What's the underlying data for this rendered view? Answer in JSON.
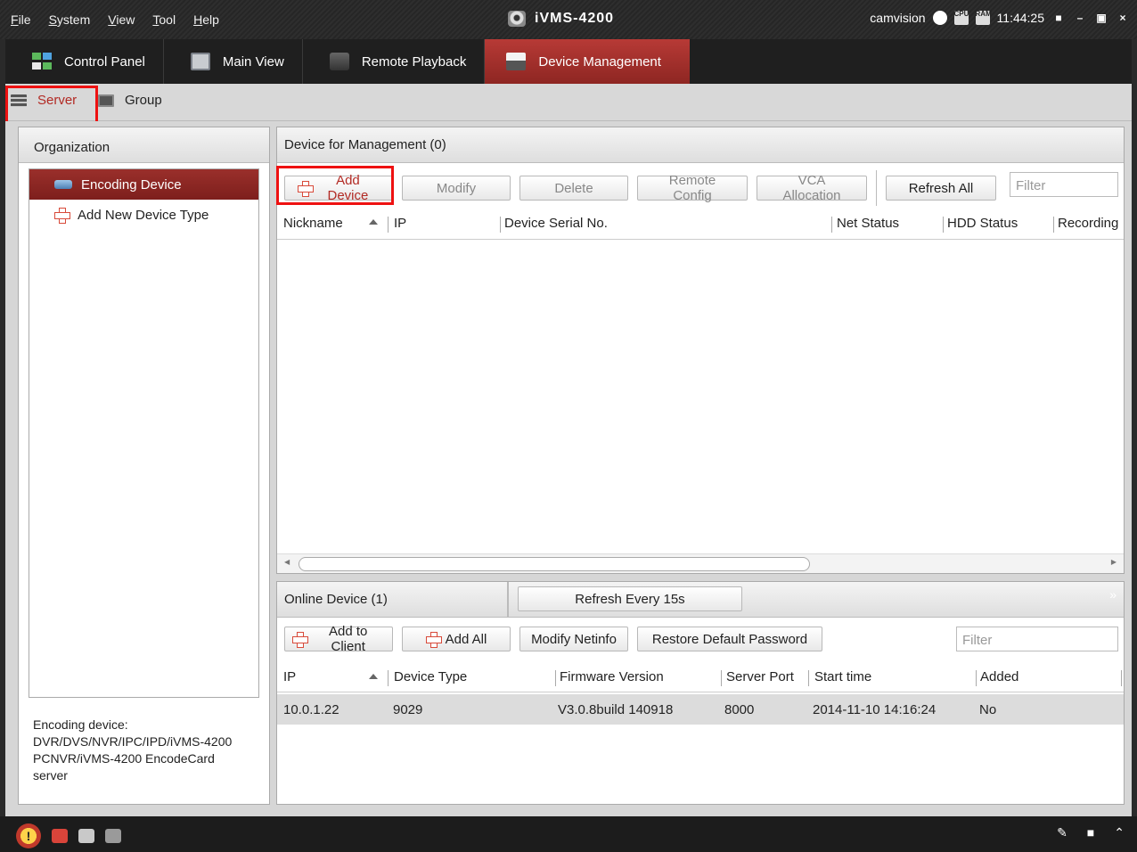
{
  "menu": [
    "File",
    "System",
    "View",
    "Tool",
    "Help"
  ],
  "app_title": "iVMS-4200",
  "user": "camvision",
  "sys_icons": {
    "cpu": "CPU",
    "ram": "RAM"
  },
  "clock": "11:44:25",
  "tabs": [
    {
      "label": "Control Panel",
      "icon": "control-panel-icon"
    },
    {
      "label": "Main View",
      "icon": "main-view-icon"
    },
    {
      "label": "Remote Playback",
      "icon": "remote-playback-icon"
    },
    {
      "label": "Device Management",
      "icon": "device-management-icon",
      "active": true
    }
  ],
  "subtabs": {
    "server": "Server",
    "group": "Group"
  },
  "organization": {
    "title": "Organization",
    "items": [
      {
        "label": "Encoding Device",
        "selected": true
      },
      {
        "label": "Add New Device Type"
      }
    ],
    "description": [
      "Encoding device:",
      "DVR/DVS/NVR/IPC/IPD/iVMS-4200",
      "PCNVR/iVMS-4200 EncodeCard",
      "server"
    ]
  },
  "management": {
    "title": "Device for Management (0)",
    "buttons": {
      "add": "Add Device",
      "modify": "Modify",
      "delete": "Delete",
      "remote_config": "Remote Config",
      "vca": "VCA Allocation",
      "refresh_all": "Refresh All"
    },
    "filter_placeholder": "Filter",
    "columns": [
      "Nickname",
      "IP",
      "Device Serial No.",
      "Net Status",
      "HDD Status",
      "Recording"
    ]
  },
  "online": {
    "title": "Online Device (1)",
    "refresh": "Refresh Every 15s",
    "buttons": {
      "add_to_client": "Add to Client",
      "add_all": "Add All",
      "modify_netinfo": "Modify Netinfo",
      "restore_password": "Restore Default Password"
    },
    "filter_placeholder": "Filter",
    "columns": [
      "IP",
      "Device Type",
      "Firmware Version",
      "Server Port",
      "Start time",
      "Added"
    ],
    "rows": [
      {
        "ip": "10.0.1.22",
        "type": "9029",
        "firmware": "V3.0.8build 140918",
        "port": "8000",
        "start": "2014-11-10 14:16:24",
        "added": "No"
      }
    ]
  },
  "colors": {
    "accent": "#b22a24",
    "highlight": "#e11111",
    "titlebar": "#2a2a2a"
  }
}
